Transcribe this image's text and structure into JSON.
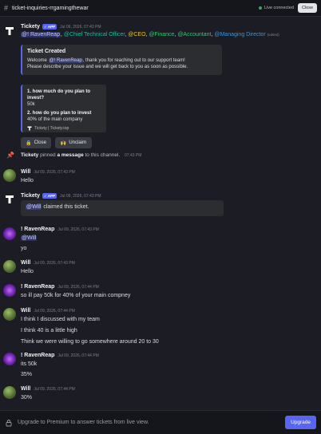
{
  "header": {
    "channel": "ticket-inquiries-rrgamingthewar",
    "status": "Live connected",
    "close_label": "Close"
  },
  "messages": {
    "m1": {
      "author": "Tickety",
      "badge": "✓ APP",
      "time": "Jul 09, 2026, 07:43 PM",
      "mentions": [
        "@! RavenReap",
        "@Chief Technical Officer",
        "@CEO",
        "@Finance",
        "@Accountant",
        "@Managing Director"
      ],
      "edited": "(edited)",
      "embed1": {
        "title": "Ticket Created",
        "text_pre": "Welcome ",
        "mention": "@! RavenReap",
        "text_post": ", thank you for reaching out to our support team!",
        "text_line2": "Please describe your issue and we will get back to you as soon as possible."
      },
      "embed2": {
        "q1": "1. how much do you plan to invest?",
        "a1": "50k",
        "q2": "2. how do you plan to invest",
        "a2": "40% of the main company",
        "footer": "Tickety | Tickety.top"
      },
      "buttons": {
        "close": "Close",
        "unclaim": "Unclaim"
      }
    },
    "sys": {
      "author": "Tickety",
      "text_mid": " pinned ",
      "link": "a message",
      "text_end": " to this channel.",
      "time": "07:43 PM"
    },
    "m2": {
      "author": "Will",
      "time": "Jul 09, 2026, 07:43 PM",
      "text": "Hello"
    },
    "m3": {
      "author": "Tickety",
      "badge": "✓ APP",
      "time": "Jul 09, 2026, 07:43 PM",
      "mention": "@Will",
      "text": " claimed this ticket."
    },
    "m4": {
      "author": "! RavenReap",
      "time": "Jul 09, 2026, 07:43 PM",
      "mention": "@Will",
      "text": "yo"
    },
    "m5": {
      "author": "Will",
      "time": "Jul 09, 2026, 07:43 PM",
      "text": "Hello"
    },
    "m6": {
      "author": "! RavenReap",
      "time": "Jul 09, 2026, 07:44 PM",
      "text": "so ill pay 50k for 40% of your main compney"
    },
    "m7": {
      "author": "Will",
      "time": "Jul 09, 2026, 07:44 PM",
      "lines": [
        "I think I discussed with my team",
        "I think 40 is a little high",
        "Think we were willing to go somewhere around 20 to 30"
      ]
    },
    "m8": {
      "author": "! RavenReap",
      "time": "Jul 09, 2026, 07:44 PM",
      "lines": [
        "its 50k",
        "35%"
      ]
    },
    "m9": {
      "author": "Will",
      "time": "Jul 09, 2026, 07:44 PM",
      "text": "30%"
    }
  },
  "footer": {
    "text": "Upgrade to Premium to answer tickets from live view.",
    "button": "Upgrade"
  },
  "colors": {
    "background": "#1b1c24",
    "accent": "#5865f2",
    "live": "#3ba55d"
  }
}
